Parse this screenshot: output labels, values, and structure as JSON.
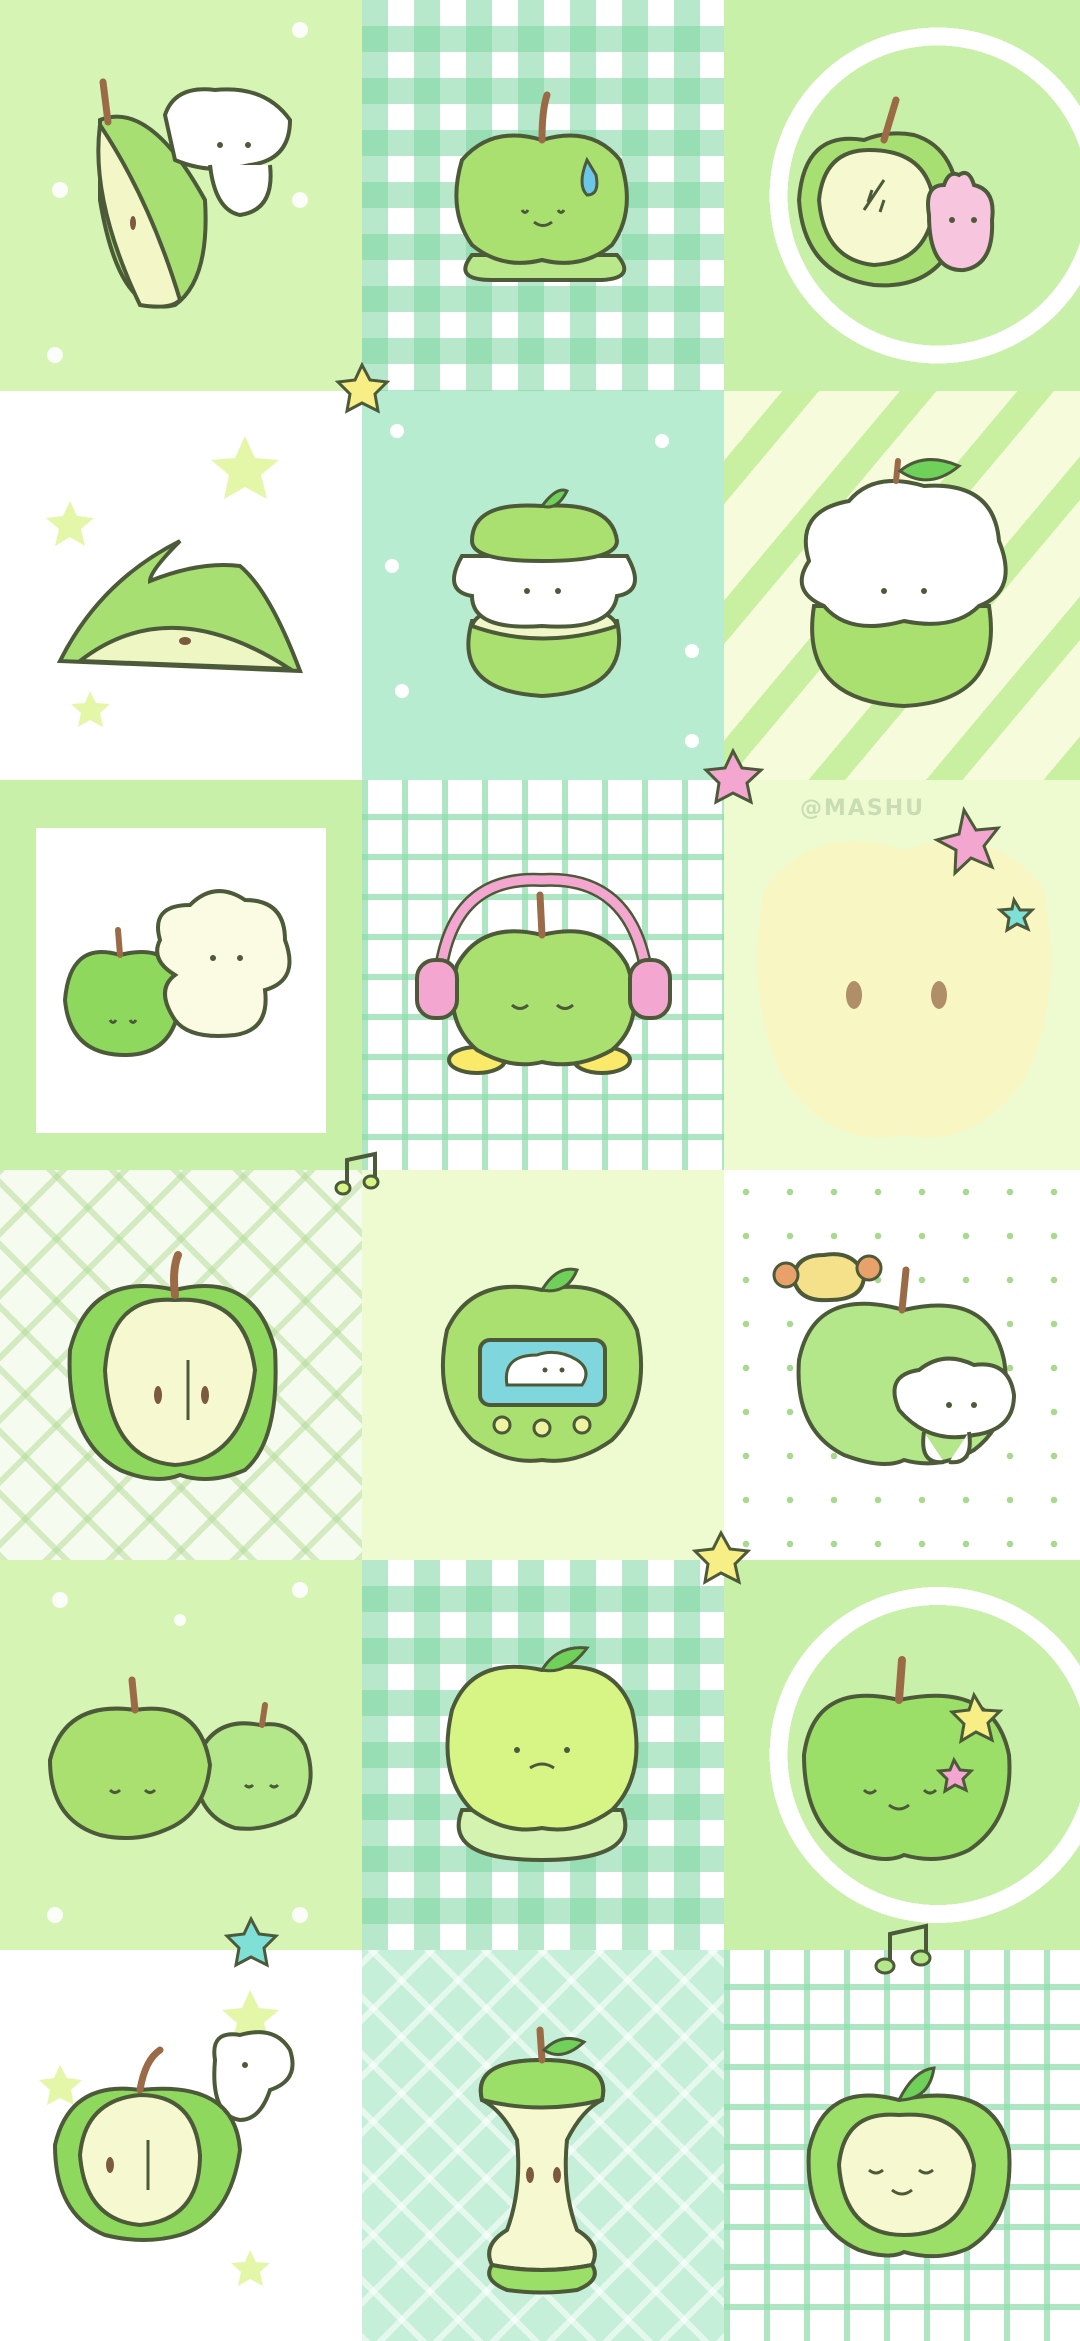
{
  "wallpaper": {
    "watermark": "@MASHU",
    "columns": 3,
    "rows": 6,
    "palette": {
      "apple_green": "#9fdc6c",
      "apple_light": "#c8ee92",
      "apple_flesh": "#f6f9cf",
      "outline": "#4c5a3a",
      "stem": "#9b6b48",
      "leaf": "#6fd05a",
      "pink": "#f3a6cf",
      "yellow_star": "#f7ef86",
      "mint_star": "#7fe0d8"
    },
    "tiles": [
      {
        "id": "r1c1",
        "background": "lime-dots",
        "subject": "apple-wedge-with-puppy"
      },
      {
        "id": "r1c2",
        "background": "gingham",
        "subject": "sweating-green-apple"
      },
      {
        "id": "r1c3",
        "background": "ring",
        "subject": "apple-half-with-pink-bunny"
      },
      {
        "id": "r2c1",
        "background": "white-stars",
        "subject": "apple-peel-slice"
      },
      {
        "id": "r2c2",
        "background": "mint-dots",
        "subject": "apple-sandwich-puppy"
      },
      {
        "id": "r2c3",
        "background": "stripes",
        "subject": "apple-with-cream-puppy"
      },
      {
        "id": "r3c1",
        "background": "frame",
        "subject": "apple-and-fluffy-puppy"
      },
      {
        "id": "r3c2",
        "background": "grid",
        "subject": "apple-with-headphones"
      },
      {
        "id": "r3c3",
        "background": "pale",
        "subject": "giant-apple-closeup"
      },
      {
        "id": "r4c1",
        "background": "plaid",
        "subject": "apple-cross-section"
      },
      {
        "id": "r4c2",
        "background": "pale",
        "subject": "apple-handheld-device"
      },
      {
        "id": "r4c3",
        "background": "dots",
        "subject": "apple-with-two-puppies"
      },
      {
        "id": "r5c1",
        "background": "lime-dots",
        "subject": "two-smiling-apples"
      },
      {
        "id": "r5c2",
        "background": "gingham",
        "subject": "sad-apple-on-cushion"
      },
      {
        "id": "r5c3",
        "background": "ring",
        "subject": "happy-apple-with-stars"
      },
      {
        "id": "r6c1",
        "background": "white-stars",
        "subject": "apple-half-with-puppy"
      },
      {
        "id": "r6c2",
        "background": "mint-plaid",
        "subject": "apple-core"
      },
      {
        "id": "r6c3",
        "background": "grid",
        "subject": "apple-ring-face"
      }
    ]
  }
}
